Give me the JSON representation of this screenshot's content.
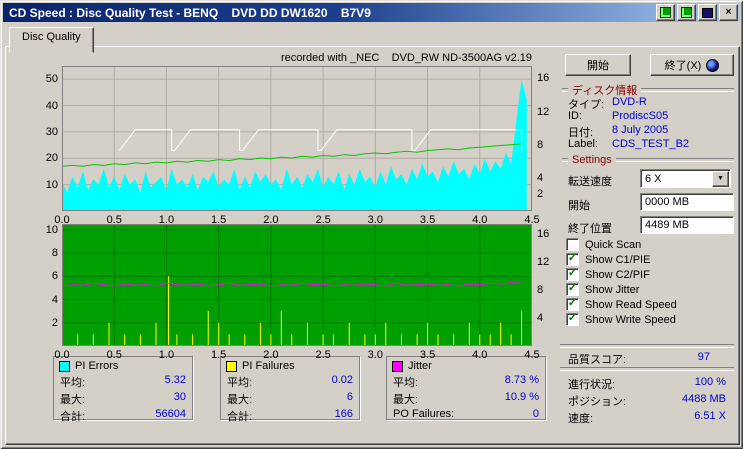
{
  "window": {
    "title": "CD Speed : Disc Quality Test - BENQ    DVD DD DW1620    B7V9",
    "close_glyph": "×"
  },
  "tab": {
    "label": "Disc Quality"
  },
  "chart_header": "recorded with _NEC    DVD_RW ND-3500AG v2.19",
  "colors": {
    "value_text": "#0000cc",
    "section_header": "#800000",
    "titlebar_icon": "#00a000",
    "check": "#007700"
  },
  "chart_data": [
    {
      "type": "area",
      "title": "PI Errors / Transfer Speed",
      "bg": "#d4d0c8",
      "grid": "#b0aca4",
      "x": {
        "min": 0,
        "max": 4.5,
        "tick_labels": [
          "0.0",
          "0.5",
          "1.0",
          "1.5",
          "2.0",
          "2.5",
          "3.0",
          "3.5",
          "4.0",
          "4.5"
        ]
      },
      "y_left": {
        "min": 0,
        "max": 55,
        "ticks": [
          50,
          40,
          30,
          20,
          10
        ]
      },
      "y_right": {
        "min": 0,
        "max": 17.5,
        "ticks": [
          16,
          12,
          8,
          4,
          2
        ]
      },
      "series": [
        {
          "name": "PI Errors",
          "color": "#00ffff",
          "axis": "left",
          "style": "area",
          "step": 0.05,
          "values": [
            11,
            7,
            13,
            9,
            15,
            8,
            12,
            10,
            16,
            9,
            13,
            8,
            14,
            10,
            12,
            7,
            15,
            9,
            11,
            13,
            8,
            16,
            10,
            12,
            9,
            14,
            8,
            13,
            11,
            15,
            9,
            12,
            10,
            16,
            8,
            13,
            9,
            15,
            11,
            14,
            10,
            12,
            8,
            16,
            10,
            13,
            9,
            14,
            11,
            16,
            9,
            13,
            10,
            15,
            8,
            14,
            10,
            16,
            11,
            13,
            9,
            15,
            10,
            17,
            12,
            14,
            10,
            16,
            12,
            18,
            13,
            15,
            11,
            17,
            13,
            19,
            14,
            16,
            12,
            18,
            14,
            20,
            15,
            19,
            16,
            22,
            18,
            34,
            50,
            42
          ]
        },
        {
          "name": "Write Speed",
          "color": "#ffffff",
          "axis": "right",
          "style": "line",
          "points": [
            [
              0.55,
              7.3
            ],
            [
              0.7,
              9.8
            ],
            [
              1.05,
              9.8
            ],
            [
              1.05,
              7.3
            ],
            [
              1.08,
              7.3
            ],
            [
              1.23,
              9.8
            ],
            [
              1.7,
              9.8
            ],
            [
              1.7,
              7.3
            ],
            [
              1.73,
              7.3
            ],
            [
              1.88,
              9.8
            ],
            [
              2.45,
              9.8
            ],
            [
              2.45,
              7.3
            ],
            [
              2.48,
              7.3
            ],
            [
              2.63,
              9.8
            ],
            [
              3.35,
              9.8
            ],
            [
              3.35,
              7.3
            ],
            [
              3.38,
              7.3
            ],
            [
              3.53,
              9.8
            ],
            [
              4.4,
              9.8
            ],
            [
              4.4,
              7.3
            ]
          ]
        },
        {
          "name": "Read Speed",
          "color": "#00c800",
          "axis": "right",
          "style": "line",
          "step": 0.1,
          "values": [
            5.4,
            5.5,
            5.4,
            5.6,
            5.5,
            5.7,
            5.6,
            5.8,
            5.7,
            5.9,
            5.8,
            6.0,
            5.9,
            6.1,
            6.0,
            6.2,
            6.1,
            6.3,
            6.2,
            6.4,
            6.3,
            6.5,
            6.4,
            6.6,
            6.5,
            6.7,
            6.6,
            6.8,
            6.7,
            6.9,
            7.0,
            6.9,
            7.1,
            7.2,
            7.1,
            7.3,
            7.4,
            7.5,
            7.4,
            7.6,
            7.7,
            7.8,
            7.9,
            8.0,
            8.1
          ]
        }
      ]
    },
    {
      "type": "line",
      "title": "Jitter / PI Failures",
      "bg": "#00a000",
      "grid": "#007800",
      "x": {
        "min": 0,
        "max": 4.5,
        "tick_labels": [
          "0.0",
          "0.5",
          "1.0",
          "1.5",
          "2.0",
          "2.5",
          "3.0",
          "3.5",
          "4.0",
          "4.5"
        ]
      },
      "y_left": {
        "min": 0,
        "max": 10.5,
        "ticks": [
          10,
          8,
          6,
          4,
          2
        ]
      },
      "y_right": {
        "min": 0,
        "max": 17.5,
        "ticks": [
          16,
          12,
          8,
          4
        ]
      },
      "series": [
        {
          "name": "PI Failures",
          "color": "#ffff00",
          "axis": "left",
          "style": "spikes",
          "points": [
            [
              0.15,
              1
            ],
            [
              0.3,
              1
            ],
            [
              0.45,
              2
            ],
            [
              0.6,
              1
            ],
            [
              0.75,
              1
            ],
            [
              0.9,
              2
            ],
            [
              1.02,
              6
            ],
            [
              1.1,
              1
            ],
            [
              1.25,
              1
            ],
            [
              1.4,
              3
            ],
            [
              1.5,
              2
            ],
            [
              1.6,
              1
            ],
            [
              1.75,
              1
            ],
            [
              1.9,
              2
            ],
            [
              2.0,
              1
            ],
            [
              2.1,
              3
            ],
            [
              2.2,
              1
            ],
            [
              2.35,
              2
            ],
            [
              2.5,
              1
            ],
            [
              2.6,
              1
            ],
            [
              2.75,
              2
            ],
            [
              2.9,
              1
            ],
            [
              3.0,
              1
            ],
            [
              3.1,
              2
            ],
            [
              3.25,
              1
            ],
            [
              3.4,
              1
            ],
            [
              3.5,
              2
            ],
            [
              3.6,
              1
            ],
            [
              3.75,
              1
            ],
            [
              3.9,
              2
            ],
            [
              4.0,
              1
            ],
            [
              4.1,
              1
            ],
            [
              4.2,
              2
            ],
            [
              4.3,
              1
            ],
            [
              4.4,
              3
            ]
          ]
        },
        {
          "name": "Jitter",
          "color": "#ff00ff",
          "axis": "right",
          "style": "line",
          "step": 0.1,
          "values": [
            8.6,
            8.8,
            8.7,
            9.0,
            8.8,
            8.6,
            8.9,
            8.7,
            8.8,
            8.6,
            9.0,
            8.8,
            8.7,
            8.9,
            8.6,
            8.8,
            9.0,
            8.7,
            8.8,
            8.9,
            8.6,
            8.8,
            8.7,
            9.0,
            8.8,
            8.9,
            8.6,
            8.8,
            8.7,
            8.9,
            8.8,
            8.6,
            9.0,
            8.7,
            8.8,
            8.9,
            8.7,
            8.8,
            8.6,
            8.9,
            8.8,
            9.0,
            8.9,
            9.1,
            9.0
          ]
        }
      ]
    }
  ],
  "right_panel": {
    "start_button": "開始",
    "exit_button": "終了(X)",
    "disc_info": {
      "header": "ディスク情報",
      "rows": [
        {
          "label": "タイプ:",
          "value": "DVD-R"
        },
        {
          "label": "ID:",
          "value": "ProdiscS05"
        },
        {
          "label": "日付:",
          "value": "8 July 2005"
        },
        {
          "label": "Label:",
          "value": "CDS_TEST_B2"
        }
      ]
    },
    "settings": {
      "header": "Settings",
      "speed_label": "転送速度",
      "speed_value": "6 X",
      "start_label": "開始",
      "start_value": "0000 MB",
      "end_label": "終了位置",
      "end_value": "4489 MB",
      "checkboxes": [
        {
          "label": "Quick Scan",
          "checked": false
        },
        {
          "label": "Show C1/PIE",
          "checked": true
        },
        {
          "label": "Show C2/PIF",
          "checked": true
        },
        {
          "label": "Show Jitter",
          "checked": true
        },
        {
          "label": "Show Read Speed",
          "checked": true
        },
        {
          "label": "Show Write Speed",
          "checked": true
        }
      ]
    },
    "score": {
      "label": "品質スコア:",
      "value": "97"
    },
    "progress": [
      {
        "label": "進行状況:",
        "value": "100 %"
      },
      {
        "label": "ポジション:",
        "value": "4488 MB"
      },
      {
        "label": "速度:",
        "value": "6.51 X"
      }
    ]
  },
  "stats": {
    "boxes": [
      {
        "legend_color": "#00ffff",
        "title": "PI Errors",
        "rows": [
          {
            "label": "平均:",
            "value": "5.32"
          },
          {
            "label": "最大:",
            "value": "30"
          },
          {
            "label": "合計:",
            "value": "56604"
          }
        ]
      },
      {
        "legend_color": "#ffff00",
        "title": "PI Failures",
        "rows": [
          {
            "label": "平均:",
            "value": "0.02"
          },
          {
            "label": "最大:",
            "value": "6"
          },
          {
            "label": "合計:",
            "value": "166"
          }
        ]
      },
      {
        "legend_color": "#ff00ff",
        "title": "Jitter",
        "rows": [
          {
            "label": "平均:",
            "value": "8.73 %"
          },
          {
            "label": "最大:",
            "value": "10.9 %"
          },
          {
            "label": "PO Failures:",
            "value": "0"
          }
        ]
      }
    ]
  }
}
